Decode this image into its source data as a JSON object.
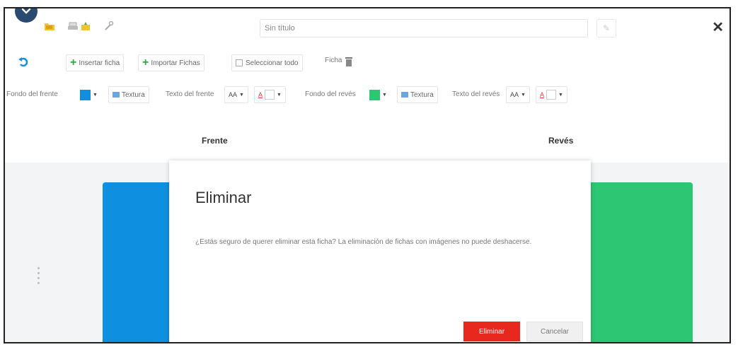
{
  "window": {
    "title": "Sin título",
    "close_label": "✕"
  },
  "toolbar": {
    "insert_card": "Insertar ficha",
    "import_cards": "Importar Fichas",
    "select_all": "Seleccionar todo",
    "card_label": "Ficha"
  },
  "format": {
    "front_bg_label": "Fondo del frente",
    "front_bg_color": "#0f8fe0",
    "texture_label": "Textura",
    "front_text_label": "Texto del frente",
    "back_bg_label": "Fondo del revés",
    "back_bg_color": "#2dc672",
    "back_texture_label": "Textura",
    "back_text_label": "Texto del revés",
    "font_size_glyph": "AA",
    "font_color_glyph": "A"
  },
  "columns": {
    "front": "Frente",
    "back": "Revés"
  },
  "dialog": {
    "title": "Eliminar",
    "message": "¿Estás seguro de querer eliminar esta ficha? La eliminación de fichas con imágenes no puede deshacerse.",
    "confirm": "Eliminar",
    "cancel": "Cancelar"
  },
  "colors": {
    "danger": "#e8281f",
    "front_card": "#0f8fe0",
    "back_card": "#2dc672"
  }
}
